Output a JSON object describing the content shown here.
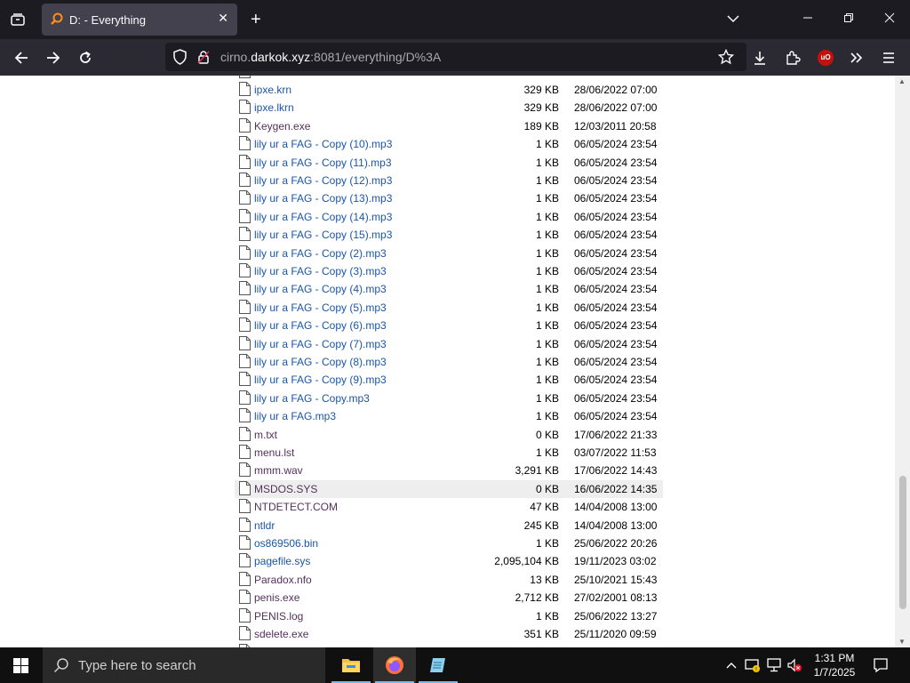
{
  "browser": {
    "tab_title": "D: - Everything",
    "url_host_prefix": "cirno.",
    "url_host": "darkok.xyz",
    "url_rest": ":8081/everything/D%3A",
    "ublock_badge": "uO"
  },
  "files": [
    {
      "name": "ipxe.krn",
      "size": "329 KB",
      "date": "28/06/2022 07:00",
      "visited": false
    },
    {
      "name": "ipxe.lkrn",
      "size": "329 KB",
      "date": "28/06/2022 07:00",
      "visited": false
    },
    {
      "name": "Keygen.exe",
      "size": "189 KB",
      "date": "12/03/2011 20:58",
      "visited": true
    },
    {
      "name": "lily ur a FAG - Copy (10).mp3",
      "size": "1 KB",
      "date": "06/05/2024 23:54",
      "visited": false
    },
    {
      "name": "lily ur a FAG - Copy (11).mp3",
      "size": "1 KB",
      "date": "06/05/2024 23:54",
      "visited": false
    },
    {
      "name": "lily ur a FAG - Copy (12).mp3",
      "size": "1 KB",
      "date": "06/05/2024 23:54",
      "visited": false
    },
    {
      "name": "lily ur a FAG - Copy (13).mp3",
      "size": "1 KB",
      "date": "06/05/2024 23:54",
      "visited": false
    },
    {
      "name": "lily ur a FAG - Copy (14).mp3",
      "size": "1 KB",
      "date": "06/05/2024 23:54",
      "visited": false
    },
    {
      "name": "lily ur a FAG - Copy (15).mp3",
      "size": "1 KB",
      "date": "06/05/2024 23:54",
      "visited": false
    },
    {
      "name": "lily ur a FAG - Copy (2).mp3",
      "size": "1 KB",
      "date": "06/05/2024 23:54",
      "visited": false
    },
    {
      "name": "lily ur a FAG - Copy (3).mp3",
      "size": "1 KB",
      "date": "06/05/2024 23:54",
      "visited": false
    },
    {
      "name": "lily ur a FAG - Copy (4).mp3",
      "size": "1 KB",
      "date": "06/05/2024 23:54",
      "visited": false
    },
    {
      "name": "lily ur a FAG - Copy (5).mp3",
      "size": "1 KB",
      "date": "06/05/2024 23:54",
      "visited": false
    },
    {
      "name": "lily ur a FAG - Copy (6).mp3",
      "size": "1 KB",
      "date": "06/05/2024 23:54",
      "visited": false
    },
    {
      "name": "lily ur a FAG - Copy (7).mp3",
      "size": "1 KB",
      "date": "06/05/2024 23:54",
      "visited": false
    },
    {
      "name": "lily ur a FAG - Copy (8).mp3",
      "size": "1 KB",
      "date": "06/05/2024 23:54",
      "visited": false
    },
    {
      "name": "lily ur a FAG - Copy (9).mp3",
      "size": "1 KB",
      "date": "06/05/2024 23:54",
      "visited": false
    },
    {
      "name": "lily ur a FAG - Copy.mp3",
      "size": "1 KB",
      "date": "06/05/2024 23:54",
      "visited": false
    },
    {
      "name": "lily ur a FAG.mp3",
      "size": "1 KB",
      "date": "06/05/2024 23:54",
      "visited": false
    },
    {
      "name": "m.txt",
      "size": "0 KB",
      "date": "17/06/2022 21:33",
      "visited": true
    },
    {
      "name": "menu.lst",
      "size": "1 KB",
      "date": "03/07/2022 11:53",
      "visited": true
    },
    {
      "name": "mmm.wav",
      "size": "3,291 KB",
      "date": "17/06/2022 14:43",
      "visited": true
    },
    {
      "name": "MSDOS.SYS",
      "size": "0 KB",
      "date": "16/06/2022 14:35",
      "visited": true,
      "highlighted": true
    },
    {
      "name": "NTDETECT.COM",
      "size": "47 KB",
      "date": "14/04/2008 13:00",
      "visited": true
    },
    {
      "name": "ntldr",
      "size": "245 KB",
      "date": "14/04/2008 13:00",
      "visited": false
    },
    {
      "name": "os869506.bin",
      "size": "1 KB",
      "date": "25/06/2022 20:26",
      "visited": false
    },
    {
      "name": "pagefile.sys",
      "size": "2,095,104 KB",
      "date": "19/11/2023 03:02",
      "visited": false
    },
    {
      "name": "Paradox.nfo",
      "size": "13 KB",
      "date": "25/10/2021 15:43",
      "visited": true
    },
    {
      "name": "penis.exe",
      "size": "2,712 KB",
      "date": "27/02/2001 08:13",
      "visited": true
    },
    {
      "name": "PENIS.log",
      "size": "1 KB",
      "date": "25/06/2022 13:27",
      "visited": true
    },
    {
      "name": "sdelete.exe",
      "size": "351 KB",
      "date": "25/11/2020 09:59",
      "visited": true
    }
  ],
  "taskbar": {
    "search_placeholder": "Type here to search",
    "time": "1:31 PM",
    "date": "1/7/2025"
  },
  "colors": {
    "link": "#1a56a6",
    "visited": "#54305c",
    "tab_bg": "#42414d",
    "toolbar_bg": "#2b2a33"
  }
}
